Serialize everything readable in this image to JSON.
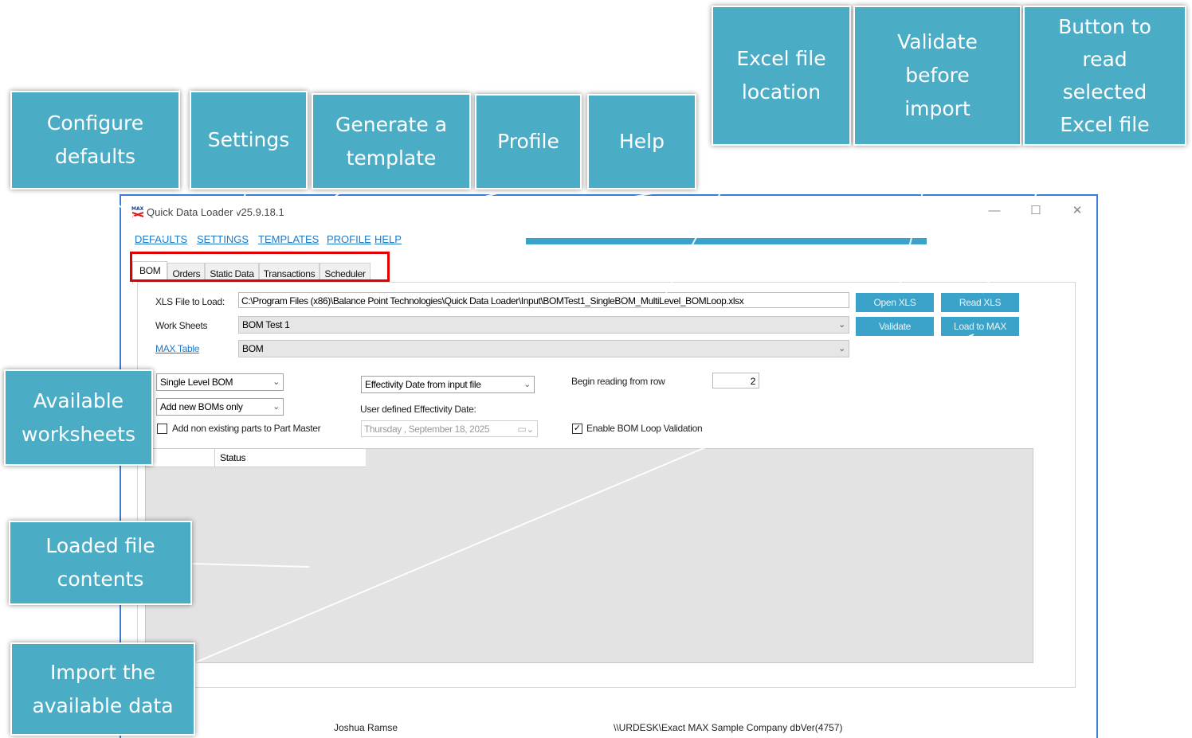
{
  "window": {
    "title": "Quick Data Loader v25.9.18.1",
    "controls": {
      "minimize": "—",
      "maximize": "☐",
      "close": "✕"
    }
  },
  "menu": [
    "DEFAULTS",
    "SETTINGS",
    "TEMPLATES",
    "PROFILE",
    "HELP"
  ],
  "tabs": [
    "BOM",
    "Orders",
    "Static Data",
    "Transactions",
    "Scheduler"
  ],
  "form": {
    "xls_label": "XLS File to Load:",
    "xls_value": "C:\\Program Files (x86)\\Balance Point Technologies\\Quick Data Loader\\Input\\BOMTest1_SingleBOM_MultiLevel_BOMLoop.xlsx",
    "worksheets_label": "Work Sheets",
    "worksheets_value": "BOM Test 1",
    "maxtable_label": "MAX Table",
    "maxtable_value": "BOM",
    "bom_level": "Single Level BOM",
    "add_mode": "Add new BOMs only",
    "add_parts_label": "Add non existing parts to Part Master",
    "effectivity_select": "Effectivity Date from input file",
    "user_date_label": "User defined Effectivity Date:",
    "user_date_day": "Thursday",
    "user_date_value": ", September 18, 2025",
    "begin_row_label": "Begin reading from row",
    "begin_row_value": "2",
    "bom_loop_label": "Enable BOM Loop Validation",
    "bom_loop_checked": true,
    "add_parts_checked": false
  },
  "buttons": {
    "open_xls": "Open XLS",
    "read_xls": "Read XLS",
    "validate": "Validate",
    "load_to_max": "Load to MAX"
  },
  "grid": {
    "columns": [
      "",
      "Status"
    ]
  },
  "statusbar": {
    "user": "Joshua Ramse",
    "connection": "\\\\URDESK\\Exact MAX Sample Company dbVer(4757)"
  },
  "callouts": {
    "configure_defaults": "Configure defaults",
    "settings": "Settings",
    "generate_template": "Generate a template",
    "profile": "Profile",
    "help": "Help",
    "excel_location": "Excel file location",
    "validate_before": "Validate before import",
    "read_button": "Button to read selected Excel file",
    "available_worksheets": "Available worksheets",
    "loaded_contents": "Loaded file contents",
    "import_data": "Import the available data"
  },
  "colors": {
    "accent": "#4bacc6",
    "button": "#3ba3c9",
    "highlight": "#e00000",
    "link": "#1e78c8"
  }
}
